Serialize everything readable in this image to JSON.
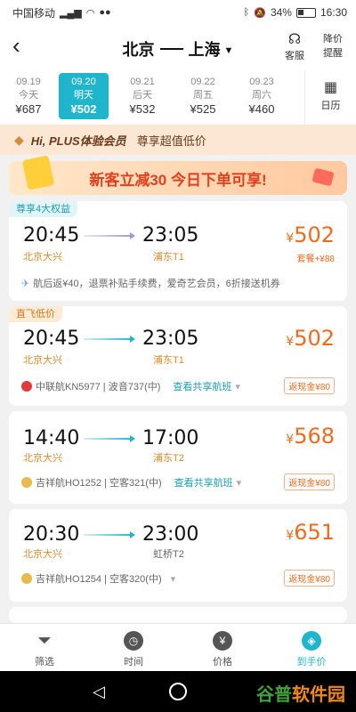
{
  "status_bar": {
    "carrier": "中国移动",
    "battery": "34%",
    "time": "16:30"
  },
  "header": {
    "from": "北京",
    "to": "上海",
    "service_label": "客服",
    "alert_label_1": "降价",
    "alert_label_2": "提醒"
  },
  "dates": [
    {
      "date": "09.19",
      "day": "今天",
      "price": "¥687",
      "active": false
    },
    {
      "date": "09.20",
      "day": "明天",
      "price": "¥502",
      "active": true
    },
    {
      "date": "09.21",
      "day": "后天",
      "price": "¥532",
      "active": false
    },
    {
      "date": "09.22",
      "day": "周五",
      "price": "¥525",
      "active": false
    },
    {
      "date": "09.23",
      "day": "周六",
      "price": "¥460",
      "active": false
    }
  ],
  "calendar_label": "日历",
  "plus_banner": {
    "title": "Hi, PLUS体验会员",
    "subtitle": "尊享超值低价"
  },
  "promo": {
    "text": "新客立减30 今日下单可享!"
  },
  "flights": [
    {
      "tag": "尊享4大权益",
      "dep_time": "20:45",
      "arr_time": "23:05",
      "dep_airport": "北京大兴",
      "arr_airport": "浦东T1",
      "price": "502",
      "subprice": "套餐+¥88",
      "benefits": "航后返¥40，退票补贴手续费，爱奇艺会员，6折接送机券"
    },
    {
      "tag": "直飞低价",
      "dep_time": "20:45",
      "arr_time": "23:05",
      "dep_airport": "北京大兴",
      "arr_airport": "浦东T1",
      "price": "502",
      "airline": "中联航KN5977 | 波音737(中)",
      "share": "查看共享航班",
      "cashback": "返现金¥80"
    },
    {
      "dep_time": "14:40",
      "arr_time": "17:00",
      "dep_airport": "北京大兴",
      "arr_airport": "浦东T2",
      "price": "568",
      "airline": "吉祥航HO1252 | 空客321(中)",
      "share": "查看共享航班",
      "cashback": "返现金¥80"
    },
    {
      "dep_time": "20:30",
      "arr_time": "23:00",
      "dep_airport": "北京大兴",
      "arr_airport": "虹桥T2",
      "price": "651",
      "airline": "吉祥航HO1254 | 空客320(中)",
      "cashback": "返现金¥80"
    }
  ],
  "bottom_nav": [
    {
      "label": "筛选",
      "icon": "funnel-icon"
    },
    {
      "label": "时间",
      "icon": "clock-icon"
    },
    {
      "label": "价格",
      "icon": "yen-icon"
    },
    {
      "label": "到手价",
      "icon": "tag-icon",
      "active": true
    }
  ],
  "watermark": {
    "part1": "谷普",
    "part2": "软件园"
  }
}
